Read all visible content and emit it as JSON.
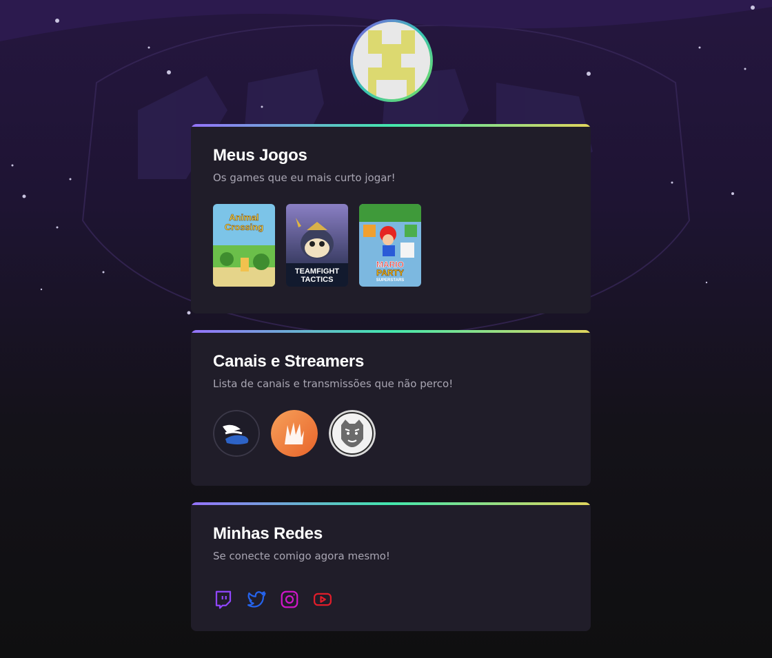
{
  "profile": {
    "avatar_icon": "pixel-smiley-avatar"
  },
  "games_section": {
    "title": "Meus Jogos",
    "subtitle": "Os games que eu mais curto jogar!",
    "games": [
      {
        "line1": "Animal",
        "line2": "Crossing"
      },
      {
        "line1": "TEAMFIGHT",
        "line2": "TACTICS"
      },
      {
        "line1": "MARIO",
        "line2": "PARTY",
        "line3": "SUPERSTARS"
      }
    ]
  },
  "channels_section": {
    "title": "Canais e Streamers",
    "subtitle": "Lista de canais e transmissões que não perco!",
    "channels": [
      {
        "icon": "winged-shoe-icon"
      },
      {
        "icon": "orange-claw-logo-icon"
      },
      {
        "icon": "tiger-head-icon"
      }
    ]
  },
  "social_section": {
    "title": "Minhas Redes",
    "subtitle": "Se conecte comigo agora mesmo!",
    "links": [
      {
        "icon": "twitch-icon",
        "color": "#9146ff"
      },
      {
        "icon": "twitter-icon",
        "color": "#1d4ed8"
      },
      {
        "icon": "instagram-icon",
        "color": "#c026d3"
      },
      {
        "icon": "youtube-icon",
        "color": "#dc2626"
      }
    ]
  }
}
